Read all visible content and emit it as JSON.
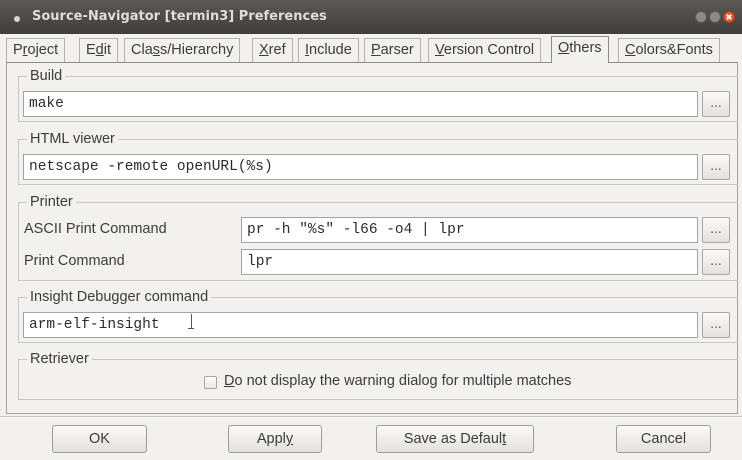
{
  "window": {
    "title": "Source-Navigator [termin3] Preferences"
  },
  "tabs": [
    {
      "pre": "P",
      "ul": "r",
      "post": "oject"
    },
    {
      "pre": "E",
      "ul": "d",
      "post": "it"
    },
    {
      "pre": "Cla",
      "ul": "s",
      "post": "s/Hierarchy"
    },
    {
      "pre": "",
      "ul": "X",
      "post": "ref"
    },
    {
      "pre": "",
      "ul": "I",
      "post": "nclude"
    },
    {
      "pre": "",
      "ul": "P",
      "post": "arser"
    },
    {
      "pre": "",
      "ul": "V",
      "post": "ersion Control"
    },
    {
      "pre": "",
      "ul": "O",
      "post": "thers"
    },
    {
      "pre": "",
      "ul": "C",
      "post": "olors&Fonts"
    }
  ],
  "active_tab": "Others",
  "build": {
    "label": "Build",
    "value": "make",
    "browse": "..."
  },
  "html_viewer": {
    "label": "HTML viewer",
    "value": "netscape -remote openURL(%s)",
    "browse": "..."
  },
  "printer": {
    "label": "Printer",
    "ascii_label": "ASCII Print Command",
    "ascii_value": "pr -h \"%s\" -l66 -o4 | lpr",
    "print_label": "Print Command",
    "print_value": "lpr",
    "browse": "..."
  },
  "insight": {
    "label": "Insight Debugger command",
    "value": "arm-elf-insight",
    "browse": "..."
  },
  "retriever": {
    "label": "Retriever",
    "checkbox_ul": "D",
    "checkbox_rest": "o not display the warning dialog for multiple matches",
    "checked": false
  },
  "buttons": {
    "ok": "OK",
    "apply_pre": "Appl",
    "apply_ul": "y",
    "save_pre": "Save as Defaul",
    "save_ul": "t",
    "cancel": "Cancel"
  }
}
